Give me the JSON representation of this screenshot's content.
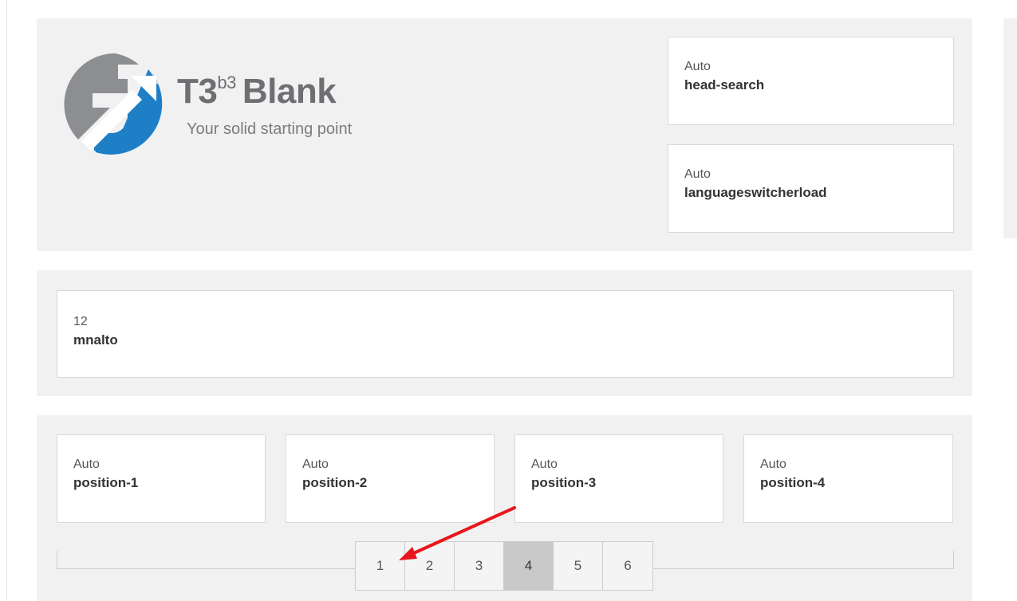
{
  "header": {
    "logo": {
      "title_main": "T3",
      "title_sup": "b3",
      "title_word": "Blank",
      "tagline": "Your solid starting point",
      "colors": {
        "gray": "#8c8e91",
        "blue": "#1e7fc6"
      }
    },
    "modules": [
      {
        "width": "Auto",
        "name": "head-search"
      },
      {
        "width": "Auto",
        "name": "languageswitcherload"
      }
    ]
  },
  "mainnav": {
    "module": {
      "width": "12",
      "name": "mnalto"
    }
  },
  "spotlight": {
    "modules": [
      {
        "width": "Auto",
        "name": "position-1"
      },
      {
        "width": "Auto",
        "name": "position-2"
      },
      {
        "width": "Auto",
        "name": "position-3"
      },
      {
        "width": "Auto",
        "name": "position-4"
      }
    ],
    "layout_options": [
      "1",
      "2",
      "3",
      "4",
      "5",
      "6"
    ],
    "active_layout": "4"
  },
  "annotation": {
    "color": "#e8161c"
  }
}
